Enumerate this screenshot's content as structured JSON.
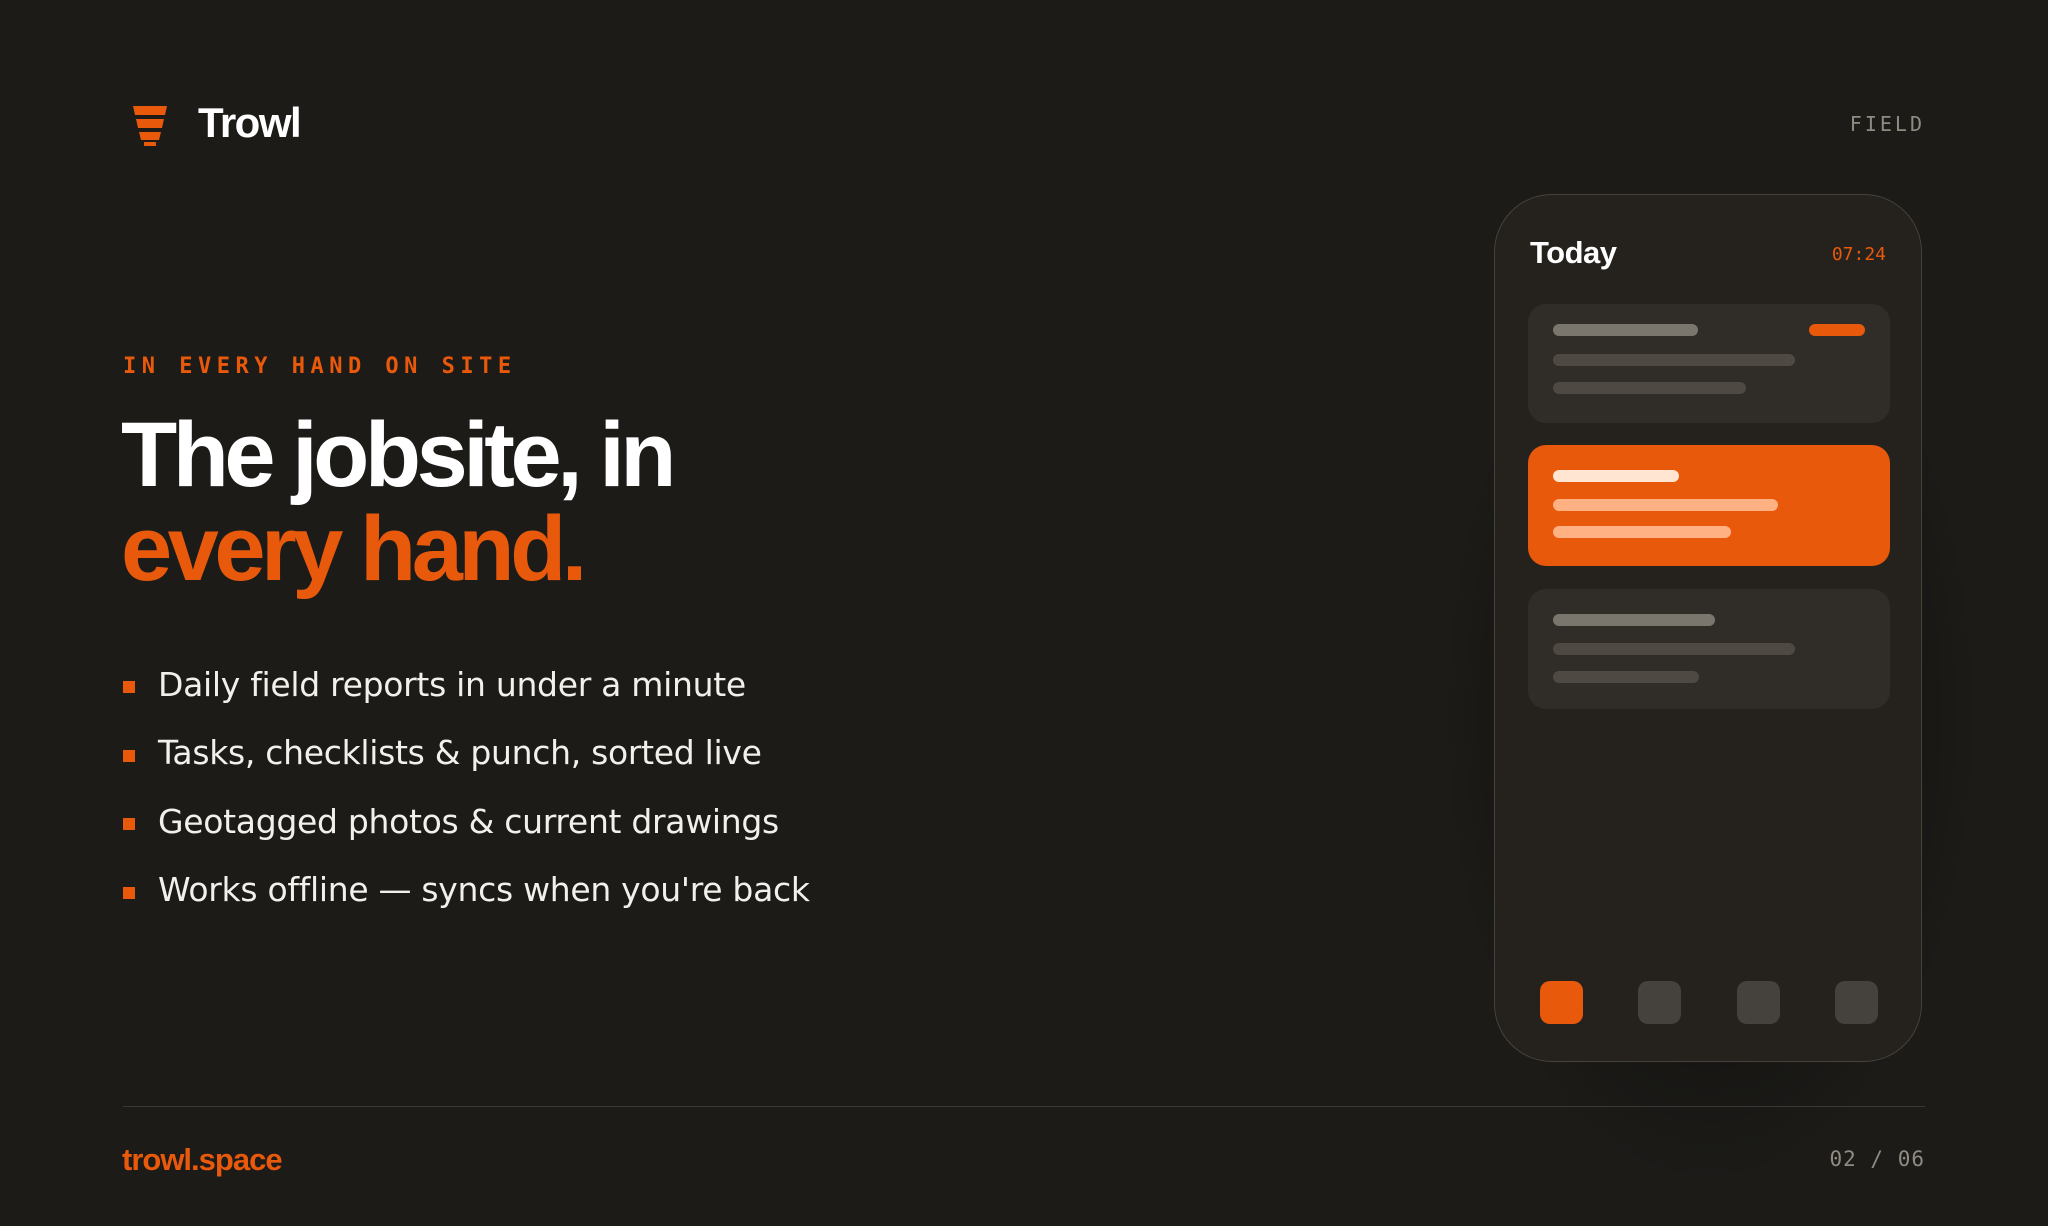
{
  "brand": {
    "name": "Trowl",
    "accent": "#e8590c",
    "icon": "trowel-icon"
  },
  "header": {
    "section_tag": "FIELD"
  },
  "hero": {
    "eyebrow": "IN EVERY HAND ON SITE",
    "headline_line1": "The jobsite, in",
    "headline_line2": "every hand.",
    "bullets": [
      "Daily field reports in under a minute",
      "Tasks, checklists & punch, sorted live",
      "Geotagged photos & current drawings",
      "Works offline — syncs when you're back"
    ]
  },
  "phone": {
    "title": "Today",
    "time": "07:24",
    "active_tab": 0,
    "tab_count": 4
  },
  "footer": {
    "site": "trowl.space",
    "page_indicator": "02 / 06"
  },
  "colors": {
    "background": "#1c1b18",
    "accent": "#e8590c",
    "card": "#302c27",
    "muted_text": "#8f8b82"
  }
}
